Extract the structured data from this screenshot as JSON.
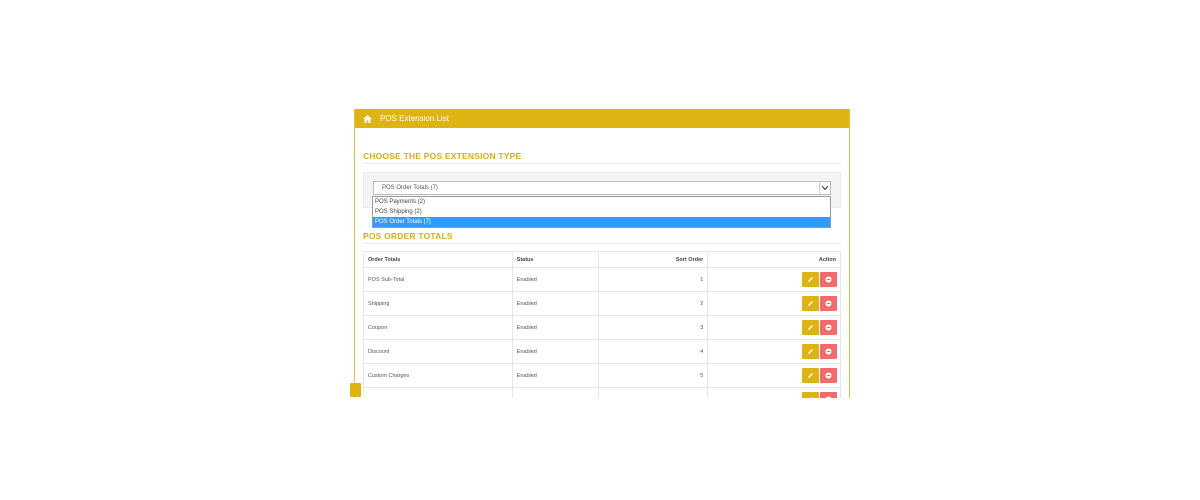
{
  "header": {
    "title": "POS Extension List",
    "icon": "home-icon"
  },
  "choose_section": {
    "title": "CHOOSE THE POS EXTENSION TYPE",
    "select_value": "POS Order Totals (7)",
    "options": [
      {
        "label": "POS Payments (2)",
        "selected": false
      },
      {
        "label": "POS Shipping (2)",
        "selected": false
      },
      {
        "label": "POS Order Totals (7)",
        "selected": true
      }
    ]
  },
  "totals_section": {
    "title": "POS ORDER TOTALS",
    "columns": [
      "Order Totals",
      "Status",
      "Sort Order",
      "Action"
    ],
    "rows": [
      {
        "name": "POS Sub-Total",
        "status": "Enabled",
        "sort": "1"
      },
      {
        "name": "Shipping",
        "status": "Enabled",
        "sort": "2"
      },
      {
        "name": "Coupon",
        "status": "Enabled",
        "sort": "3"
      },
      {
        "name": "Discount",
        "status": "Enabled",
        "sort": "4"
      },
      {
        "name": "Custom Charges",
        "status": "Enabled",
        "sort": "5"
      },
      {
        "name": "",
        "status": "",
        "sort": ""
      }
    ]
  },
  "colors": {
    "accent": "#ddb413",
    "danger": "#f06b6b",
    "selected": "#3399ff"
  }
}
